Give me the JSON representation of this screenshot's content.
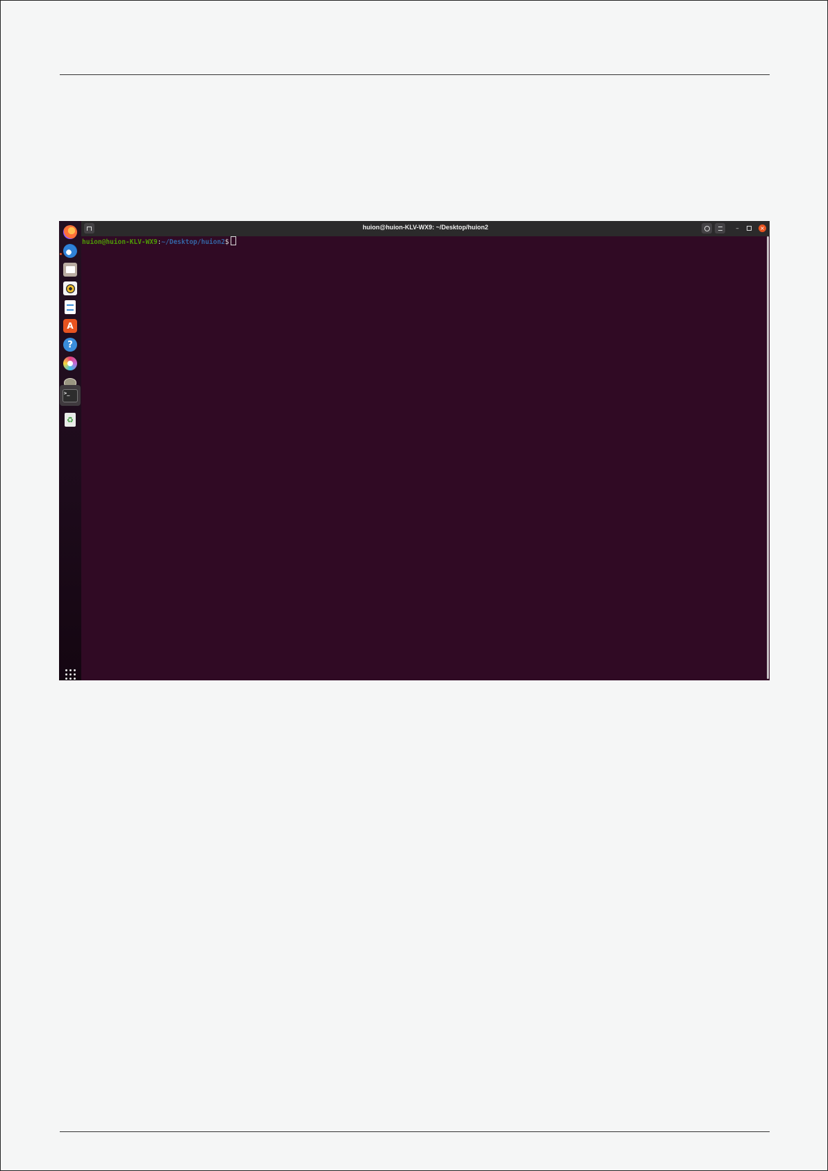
{
  "terminal": {
    "title": "huion@huion-KLV-WX9: ~/Desktop/huion2",
    "prompt_user": "huion@huion-KLV-WX9",
    "prompt_colon": ":",
    "prompt_path": "~/Desktop/huion2",
    "prompt_symbol": "$",
    "buttons": {
      "new_tab_icon": "new-tab-icon",
      "search_icon": "search-icon",
      "menu_icon": "hamburger-menu-icon",
      "minimize_glyph": "–",
      "maximize_glyph": "▫",
      "close_glyph": "×"
    }
  },
  "dock": {
    "items": [
      {
        "name": "firefox-icon",
        "color": "#ff7139"
      },
      {
        "name": "thunderbird-icon",
        "color": "#2f82d8"
      },
      {
        "name": "files-icon",
        "color": "#b9ada2"
      },
      {
        "name": "rhythmbox-icon",
        "color": "#f2c12e"
      },
      {
        "name": "libreoffice-writer-icon",
        "color": "#3a8ddb"
      },
      {
        "name": "app-center-icon",
        "color": "#e95420"
      },
      {
        "name": "help-icon",
        "color": "#3a8ddb",
        "glyph": "?"
      },
      {
        "name": "krita-icon",
        "color": "#c06bd8"
      },
      {
        "name": "gimp-icon",
        "color": "#8a8a7a"
      },
      {
        "name": "terminal-icon",
        "color": "#2d2d2d",
        "glyph": ">_"
      },
      {
        "name": "trash-icon",
        "color": "#cfd3cf",
        "glyph": "♻"
      }
    ],
    "show_apps_icon": "show-applications-icon",
    "accent": "#e95420"
  }
}
